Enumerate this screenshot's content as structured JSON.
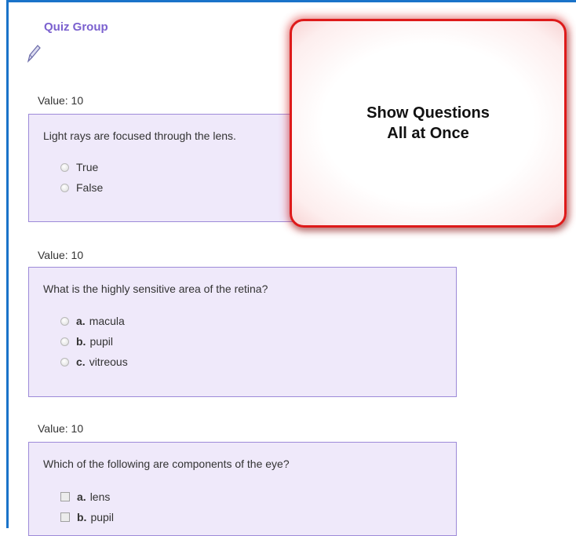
{
  "group_title": "Quiz Group",
  "callout": {
    "line1": "Show Questions",
    "line2": "All at Once"
  },
  "questions": [
    {
      "value_label": "Value: 10",
      "text": "Light rays are focused through the lens.",
      "input_type": "radio",
      "options": [
        {
          "letter": "",
          "label": "True"
        },
        {
          "letter": "",
          "label": "False"
        }
      ]
    },
    {
      "value_label": "Value: 10",
      "text": "What is the highly sensitive area of the retina?",
      "input_type": "radio",
      "options": [
        {
          "letter": "a.",
          "label": "macula"
        },
        {
          "letter": "b.",
          "label": "pupil"
        },
        {
          "letter": "c.",
          "label": "vitreous"
        }
      ]
    },
    {
      "value_label": "Value: 10",
      "text": "Which of the following are components of the eye?",
      "input_type": "checkbox",
      "options": [
        {
          "letter": "a.",
          "label": "lens"
        },
        {
          "letter": "b.",
          "label": "pupil"
        }
      ]
    }
  ],
  "colors": {
    "frame": "#1a73c9",
    "title": "#7b61cf",
    "question_bg": "#efe9fa",
    "question_border": "#9d8ad8",
    "callout_border": "#de1a1a"
  }
}
